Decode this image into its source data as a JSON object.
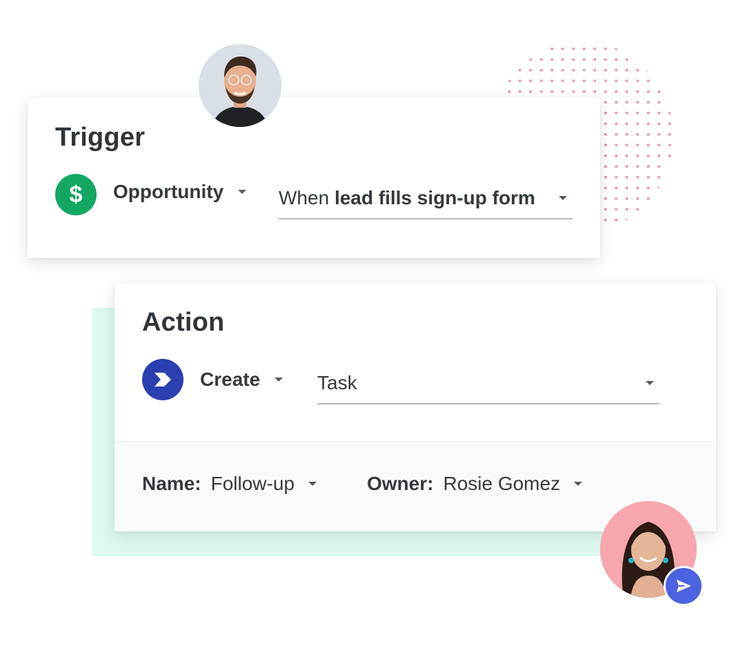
{
  "trigger": {
    "title": "Trigger",
    "icon": "dollar-icon",
    "icon_glyph": "$",
    "icon_color": "#13a862",
    "object_label": "Opportunity",
    "condition_prefix": "When ",
    "condition_value": "lead fills sign-up form"
  },
  "action": {
    "title": "Action",
    "icon": "chevron-right-icon",
    "icon_color": "#2b3fb0",
    "verb_label": "Create",
    "object_value": "Task",
    "name_label": "Name:",
    "name_value": "Follow-up",
    "owner_label": "Owner:",
    "owner_value": "Rosie Gomez"
  },
  "decor": {
    "dot_color": "#f48fa8",
    "mint_color": "#dcfaf2",
    "send_icon": "send-icon",
    "send_color": "#4b63e0"
  }
}
